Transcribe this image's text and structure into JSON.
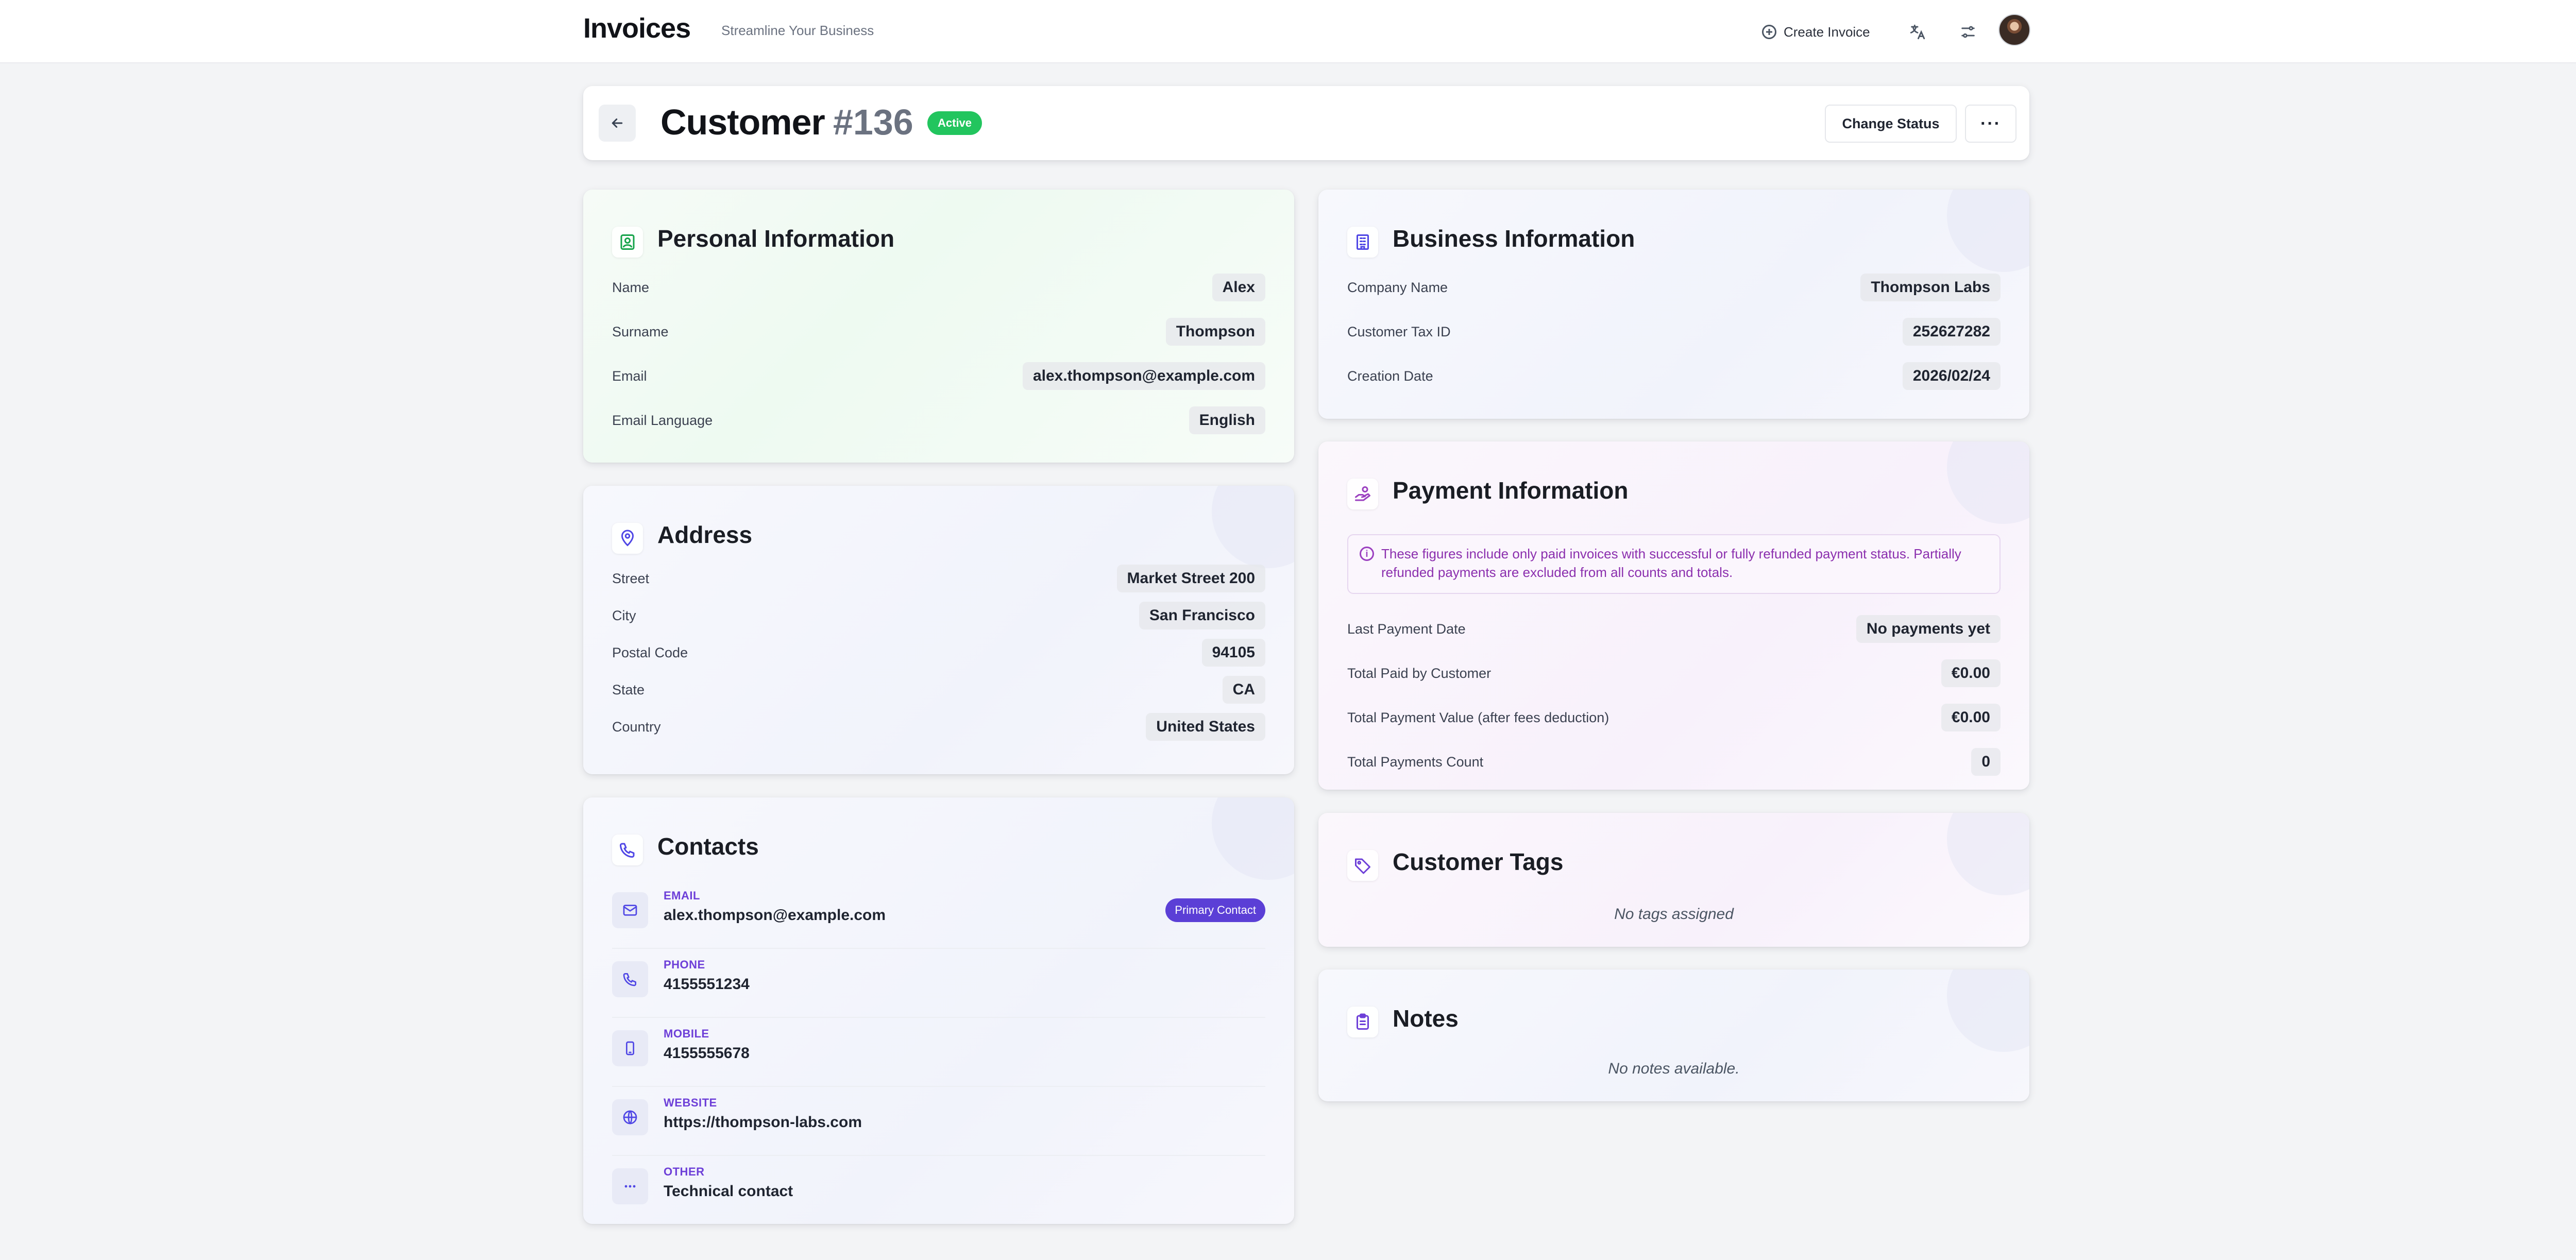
{
  "topbar": {
    "brand": "Invoices",
    "tagline": "Streamline Your Business",
    "create_label": "Create Invoice"
  },
  "header": {
    "title": "Customer",
    "id": "#136",
    "status": "Active",
    "change_status_label": "Change Status",
    "more_label": "···"
  },
  "personal": {
    "title": "Personal Information",
    "rows": [
      {
        "label": "Name",
        "value": "Alex"
      },
      {
        "label": "Surname",
        "value": "Thompson"
      },
      {
        "label": "Email",
        "value": "alex.thompson@example.com"
      },
      {
        "label": "Email Language",
        "value": "English"
      }
    ]
  },
  "address": {
    "title": "Address",
    "rows": [
      {
        "label": "Street",
        "value": "Market Street 200"
      },
      {
        "label": "City",
        "value": "San Francisco"
      },
      {
        "label": "Postal Code",
        "value": "94105"
      },
      {
        "label": "State",
        "value": "CA"
      },
      {
        "label": "Country",
        "value": "United States"
      }
    ]
  },
  "contacts": {
    "title": "Contacts",
    "primary_label": "Primary Contact",
    "items": [
      {
        "type": "EMAIL",
        "value": "alex.thompson@example.com",
        "icon": "mail-icon"
      },
      {
        "type": "PHONE",
        "value": "4155551234",
        "icon": "phone-icon"
      },
      {
        "type": "MOBILE",
        "value": "4155555678",
        "icon": "mobile-icon"
      },
      {
        "type": "WEBSITE",
        "value": "https://thompson-labs.com",
        "icon": "globe-icon"
      },
      {
        "type": "OTHER",
        "value": "Technical contact",
        "icon": "dots-icon"
      }
    ]
  },
  "business": {
    "title": "Business Information",
    "rows": [
      {
        "label": "Company Name",
        "value": "Thompson Labs"
      },
      {
        "label": "Customer Tax ID",
        "value": "252627282"
      },
      {
        "label": "Creation Date",
        "value": "2026/02/24"
      }
    ]
  },
  "payment": {
    "title": "Payment Information",
    "notice": "These figures include only paid invoices with successful or fully refunded payment status. Partially refunded payments are excluded from all counts and totals.",
    "rows": [
      {
        "label": "Last Payment Date",
        "value": "No payments yet"
      },
      {
        "label": "Total Paid by Customer",
        "value": "€0.00"
      },
      {
        "label": "Total Payment Value (after fees deduction)",
        "value": "€0.00"
      },
      {
        "label": "Total Payments Count",
        "value": "0"
      }
    ]
  },
  "tags": {
    "title": "Customer Tags",
    "empty": "No tags assigned"
  },
  "notes": {
    "title": "Notes",
    "empty": "No notes available."
  },
  "colors": {
    "active": "#22c55e",
    "accent": "#5b3fd6",
    "notice": "#8b2fae"
  }
}
